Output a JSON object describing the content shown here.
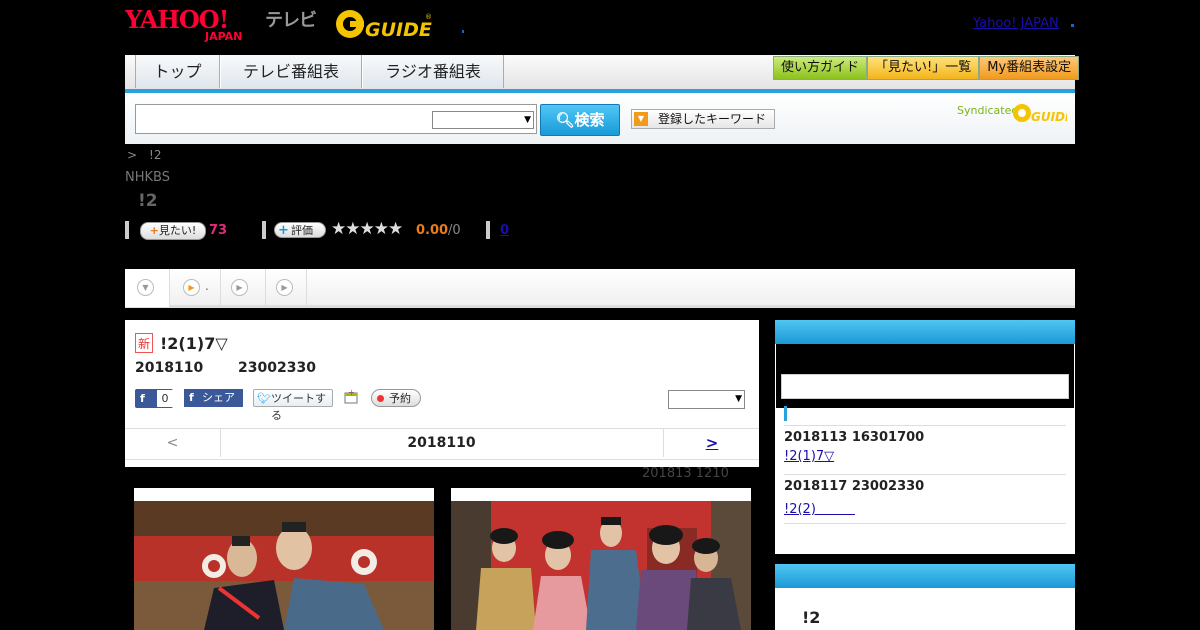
{
  "header": {
    "yahoo_logo": "YAHOO! JAPAN",
    "tv_label": "テレビ",
    "gguide_logo": "G-GUIDE",
    "yahoo_japan_link": "Yahoo! JAPAN"
  },
  "nav": {
    "tabs": [
      "トップ",
      "テレビ番組表",
      "ラジオ番組表"
    ],
    "buttons": [
      {
        "label": "使い方ガイド",
        "color": "#8bc21c"
      },
      {
        "label": "「見たい!」一覧",
        "color": "#f3b41c"
      },
      {
        "label": "My番組表設定",
        "color": "#f19a1c"
      }
    ]
  },
  "search": {
    "button_label": "検索",
    "keyword_button": "登録したキーワード",
    "syndicated": "Syndicated"
  },
  "program": {
    "breadcrumb": ">　!2",
    "channel": "NHKBS",
    "title": "!2",
    "mitai_label": "見たい!",
    "mitai_count": "73",
    "hyoka_label": "評価",
    "stars": "★★★★★",
    "score": "0.00",
    "score_max": "/0",
    "review_link": "0"
  },
  "tabs": [
    {
      "icon": "down-circle-icon",
      "label": ""
    },
    {
      "icon": "play-circle-icon",
      "label": "."
    },
    {
      "icon": "play-circle-icon",
      "label": ""
    },
    {
      "icon": "play-circle-icon",
      "label": ""
    }
  ],
  "episode": {
    "new_badge": "新",
    "title": "!2(1)7▽",
    "date": "2018110",
    "time": "23002330",
    "fb_count": "0",
    "share_label": "シェア",
    "tweet_label": "ツイートする",
    "reserve_label": "予約",
    "pager": {
      "prev": "<",
      "date": "2018110",
      "next": ">"
    },
    "updated": "201813  1210"
  },
  "sidebar": {
    "schedule": [
      {
        "datetime": "2018113  16301700",
        "title": "!2(1)7▽"
      },
      {
        "datetime": "2018117  23002330",
        "title": "!2(2)　　　"
      }
    ],
    "box2_title": "!2"
  },
  "colors": {
    "accent_blue": "#2ba2dd",
    "mitai_pink": "#e22a7a",
    "score_orange": "#e87d1e",
    "facebook": "#3b5998"
  }
}
